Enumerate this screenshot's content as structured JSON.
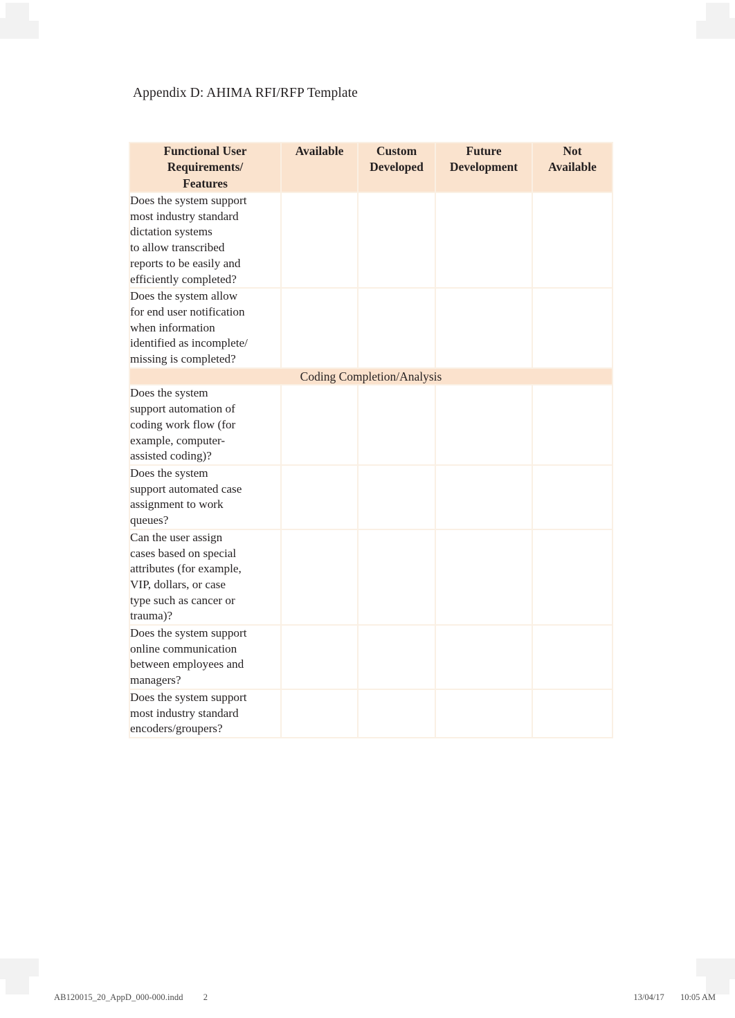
{
  "document": {
    "title": "Appendix D: AHIMA RFI/RFP Template"
  },
  "table": {
    "columns": [
      "Functional User Requirements/ Features",
      "Available",
      "Custom Developed",
      "Future Development",
      "Not Available"
    ],
    "column_lines": {
      "requirements": [
        "Functional User",
        "Requirements/",
        "Features"
      ],
      "available": [
        "Available"
      ],
      "custom_developed": [
        "Custom",
        "Developed"
      ],
      "future_development": [
        "Future",
        "Development"
      ],
      "not_available": [
        "Not",
        "Available"
      ]
    },
    "rows": [
      {
        "type": "question",
        "text": "Does the system support most industry standard dictation systems to allow transcribed reports to be easily and efficiently completed?",
        "lines": [
          "Does the system support",
          "most industry standard",
          "dictation systems",
          "to allow transcribed",
          "reports to be easily and",
          "efficiently completed?"
        ],
        "available": "",
        "custom_developed": "",
        "future_development": "",
        "not_available": ""
      },
      {
        "type": "question",
        "text": "Does the system allow for end user notification when information identified as incomplete/ missing is completed?",
        "lines": [
          "Does the system allow",
          "for end user notification",
          "when information",
          "identified as incomplete/",
          "missing is completed?"
        ],
        "available": "",
        "custom_developed": "",
        "future_development": "",
        "not_available": ""
      },
      {
        "type": "section",
        "text": "Coding Completion/Analysis"
      },
      {
        "type": "question",
        "text": "Does the system support automation of coding work flow (for example, computer-assisted coding)?",
        "lines": [
          "Does the system",
          "support automation of",
          "coding work flow (for",
          "example, computer-",
          "assisted coding)?"
        ],
        "available": "",
        "custom_developed": "",
        "future_development": "",
        "not_available": ""
      },
      {
        "type": "question",
        "text": "Does the system support automated case assignment to work queues?",
        "lines": [
          "Does the system",
          "support automated case",
          "assignment to work",
          "queues?"
        ],
        "available": "",
        "custom_developed": "",
        "future_development": "",
        "not_available": ""
      },
      {
        "type": "question",
        "text": "Can the user assign cases based on special attributes (for example, VIP, dollars, or case type such as cancer or trauma)?",
        "lines": [
          "Can the user assign",
          "cases based on special",
          "attributes (for example,",
          "VIP, dollars, or case",
          "type such as cancer or",
          "trauma)?"
        ],
        "available": "",
        "custom_developed": "",
        "future_development": "",
        "not_available": ""
      },
      {
        "type": "question",
        "text": "Does the system support online communication between employees and managers?",
        "lines": [
          "Does the system support",
          "online communication",
          "between employees and",
          "managers?"
        ],
        "available": "",
        "custom_developed": "",
        "future_development": "",
        "not_available": ""
      },
      {
        "type": "question",
        "text": "Does the system support most industry standard encoders/groupers?",
        "lines": [
          "Does the system support",
          "most industry standard",
          "encoders/groupers?"
        ],
        "available": "",
        "custom_developed": "",
        "future_development": "",
        "not_available": ""
      }
    ]
  },
  "footer": {
    "filename": "AB120015_20_AppD_000-000.indd",
    "page_number": "2",
    "date": "13/04/17",
    "time": "10:05 AM"
  },
  "colors": {
    "header_background": "#fae3ce",
    "section_background": "#fbe2cd",
    "table_background": "#faf0e4",
    "cell_background": "#ffffff",
    "text": "#231f20",
    "footer_text": "#4a4a4a"
  }
}
